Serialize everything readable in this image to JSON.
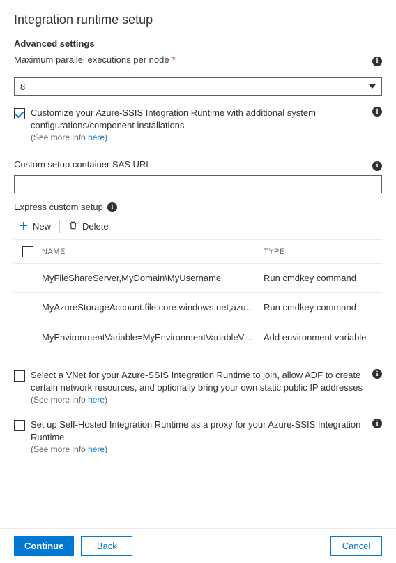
{
  "title": "Integration runtime setup",
  "advanced": {
    "sectionTitle": "Advanced settings",
    "maxParallel": {
      "label": "Maximum parallel executions per node",
      "value": "8"
    },
    "customize": {
      "checked": true,
      "text": "Customize your Azure-SSIS Integration Runtime with additional system configurations/component installations",
      "moreInfoPrefix": "(See more info ",
      "moreInfoLink": "here",
      "moreInfoSuffix": ")"
    },
    "sasUri": {
      "label": "Custom setup container SAS URI",
      "value": ""
    },
    "express": {
      "label": "Express custom setup",
      "newLabel": "New",
      "deleteLabel": "Delete",
      "columns": {
        "name": "NAME",
        "type": "TYPE"
      },
      "rows": [
        {
          "name": "MyFileShareServer,MyDomain\\MyUsername",
          "type": "Run cmdkey command"
        },
        {
          "name": "MyAzureStorageAccount.file.core.windows.net,azu...",
          "type": "Run cmdkey command"
        },
        {
          "name": "MyEnvironmentVariable=MyEnvironmentVariableValu...",
          "type": "Add environment variable"
        }
      ]
    },
    "vnet": {
      "checked": false,
      "text": "Select a VNet for your Azure-SSIS Integration Runtime to join, allow ADF to create certain network resources, and optionally bring your own static public IP addresses",
      "moreInfoPrefix": "(See more info ",
      "moreInfoLink": "here",
      "moreInfoSuffix": ")"
    },
    "selfHosted": {
      "checked": false,
      "text": "Set up Self-Hosted Integration Runtime as a proxy for your Azure-SSIS Integration Runtime",
      "moreInfoPrefix": "(See more info ",
      "moreInfoLink": "here",
      "moreInfoSuffix": ")"
    }
  },
  "footer": {
    "continue": "Continue",
    "back": "Back",
    "cancel": "Cancel"
  }
}
